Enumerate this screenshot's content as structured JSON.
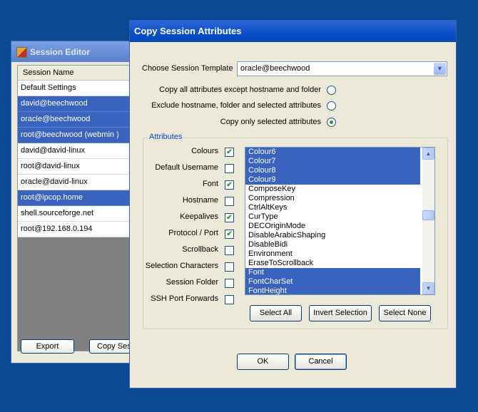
{
  "session_editor": {
    "title": "Session Editor",
    "column_header": "Session Name",
    "sessions": [
      {
        "name": "Default Settings",
        "selected": false
      },
      {
        "name": "david@beechwood",
        "selected": true
      },
      {
        "name": "oracle@beechwood",
        "selected": true
      },
      {
        "name": "root@beechwood (webmin )",
        "selected": true
      },
      {
        "name": "david@david-linux",
        "selected": false
      },
      {
        "name": "root@david-linux",
        "selected": false
      },
      {
        "name": "oracle@david-linux",
        "selected": false
      },
      {
        "name": "root@ipcop.home",
        "selected": true
      },
      {
        "name": "shell.sourceforge.net",
        "selected": false
      },
      {
        "name": "root@192.168.0.194",
        "selected": false
      }
    ],
    "export_label": "Export",
    "copy_label": "Copy Session Attributes"
  },
  "dialog": {
    "title": "Copy Session Attributes",
    "template_label": "Choose Session Template",
    "template_value": "oracle@beechwood",
    "options": [
      {
        "label": "Copy all attributes except hostname and folder",
        "selected": false
      },
      {
        "label": "Exclude hostname, folder and selected attributes",
        "selected": false
      },
      {
        "label": "Copy only selected attributes",
        "selected": true
      }
    ],
    "group_title": "Attributes",
    "attributes": [
      {
        "label": "Colours",
        "checked": true
      },
      {
        "label": "Default Username",
        "checked": false
      },
      {
        "label": "Font",
        "checked": true
      },
      {
        "label": "Hostname",
        "checked": false
      },
      {
        "label": "Keepalives",
        "checked": true
      },
      {
        "label": "Protocol / Port",
        "checked": true
      },
      {
        "label": "Scrollback",
        "checked": false
      },
      {
        "label": "Selection Characters",
        "checked": false
      },
      {
        "label": "Session Folder",
        "checked": false
      },
      {
        "label": "SSH Port Forwards",
        "checked": false
      }
    ],
    "attr_list": [
      {
        "name": "Colour6",
        "selected": true
      },
      {
        "name": "Colour7",
        "selected": true
      },
      {
        "name": "Colour8",
        "selected": true
      },
      {
        "name": "Colour9",
        "selected": true
      },
      {
        "name": "ComposeKey",
        "selected": false
      },
      {
        "name": "Compression",
        "selected": false
      },
      {
        "name": "CtrlAltKeys",
        "selected": false
      },
      {
        "name": "CurType",
        "selected": false
      },
      {
        "name": "DECOriginMode",
        "selected": false
      },
      {
        "name": "DisableArabicShaping",
        "selected": false
      },
      {
        "name": "DisableBidi",
        "selected": false
      },
      {
        "name": "Environment",
        "selected": false
      },
      {
        "name": "EraseToScrollback",
        "selected": false
      },
      {
        "name": "Font",
        "selected": true
      },
      {
        "name": "FontCharSet",
        "selected": true
      },
      {
        "name": "FontHeight",
        "selected": true
      }
    ],
    "select_all_label": "Select All",
    "invert_label": "Invert Selection",
    "select_none_label": "Select None",
    "ok_label": "OK",
    "cancel_label": "Cancel"
  },
  "colors": {
    "desktop": "#0a4a95",
    "selection": "#3a62bf",
    "window_face": "#ece9d8"
  }
}
